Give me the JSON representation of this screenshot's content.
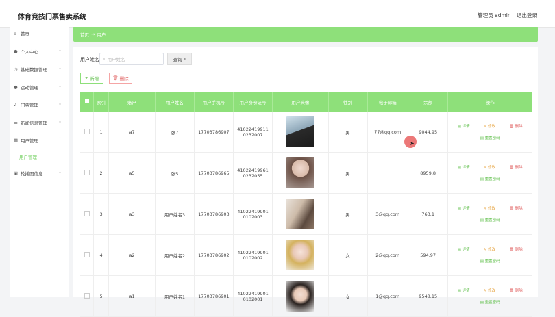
{
  "header": {
    "title": "体育竞技门票售卖系统",
    "user": "管理员 admin",
    "logout": "退出登录"
  },
  "sidebar": {
    "items": [
      {
        "label": "首页",
        "icon": "home-icon"
      },
      {
        "label": "个人中心",
        "icon": "user-icon"
      },
      {
        "label": "基础数据管理",
        "icon": "clock-icon"
      },
      {
        "label": "运动管理",
        "icon": "user-icon"
      },
      {
        "label": "门票管理",
        "icon": "mic-icon"
      },
      {
        "label": "新闻信息管理",
        "icon": "list-icon"
      },
      {
        "label": "用户管理",
        "icon": "grid-icon"
      },
      {
        "label": "轮播图信息",
        "icon": "image-icon"
      }
    ],
    "sub_item": "用户管理"
  },
  "breadcrumb": {
    "home": "首页",
    "arrow": "→",
    "current": "用户"
  },
  "search": {
    "label": "用户姓名",
    "placeholder": "用户姓名",
    "button": "查询"
  },
  "actions": {
    "add": "新增",
    "delete": "删除"
  },
  "table": {
    "headers": [
      "索引",
      "账户",
      "用户姓名",
      "用户手机号",
      "用户身份证号",
      "用户头像",
      "性别",
      "电子邮箱",
      "余额",
      "操作"
    ],
    "rows": [
      {
        "index": "1",
        "account": "a7",
        "name": "张7",
        "phone": "17703786907",
        "id_card": "410224199110232007",
        "gender": "男",
        "email": "77@qq.com",
        "balance": "9044.95"
      },
      {
        "index": "2",
        "account": "a5",
        "name": "张5",
        "phone": "17703786965",
        "id_card": "410224199610232055",
        "gender": "男",
        "email": "",
        "balance": "8959.8"
      },
      {
        "index": "3",
        "account": "a3",
        "name": "用户姓名3",
        "phone": "17703786903",
        "id_card": "410224199010102003",
        "gender": "男",
        "email": "3@qq.com",
        "balance": "763.1"
      },
      {
        "index": "4",
        "account": "a2",
        "name": "用户姓名2",
        "phone": "17703786902",
        "id_card": "410224199010102002",
        "gender": "女",
        "email": "2@qq.com",
        "balance": "594.97"
      },
      {
        "index": "5",
        "account": "a1",
        "name": "用户姓名1",
        "phone": "17703786901",
        "id_card": "410224199010102001",
        "gender": "女",
        "email": "1@qq.com",
        "balance": "9548.15"
      }
    ],
    "ops": {
      "detail": "详情",
      "edit": "修改",
      "delete": "删除",
      "reset": "重置密码"
    }
  },
  "colors": {
    "accent": "#8ee07a",
    "danger": "#e06060",
    "warning": "#e6a23c"
  }
}
